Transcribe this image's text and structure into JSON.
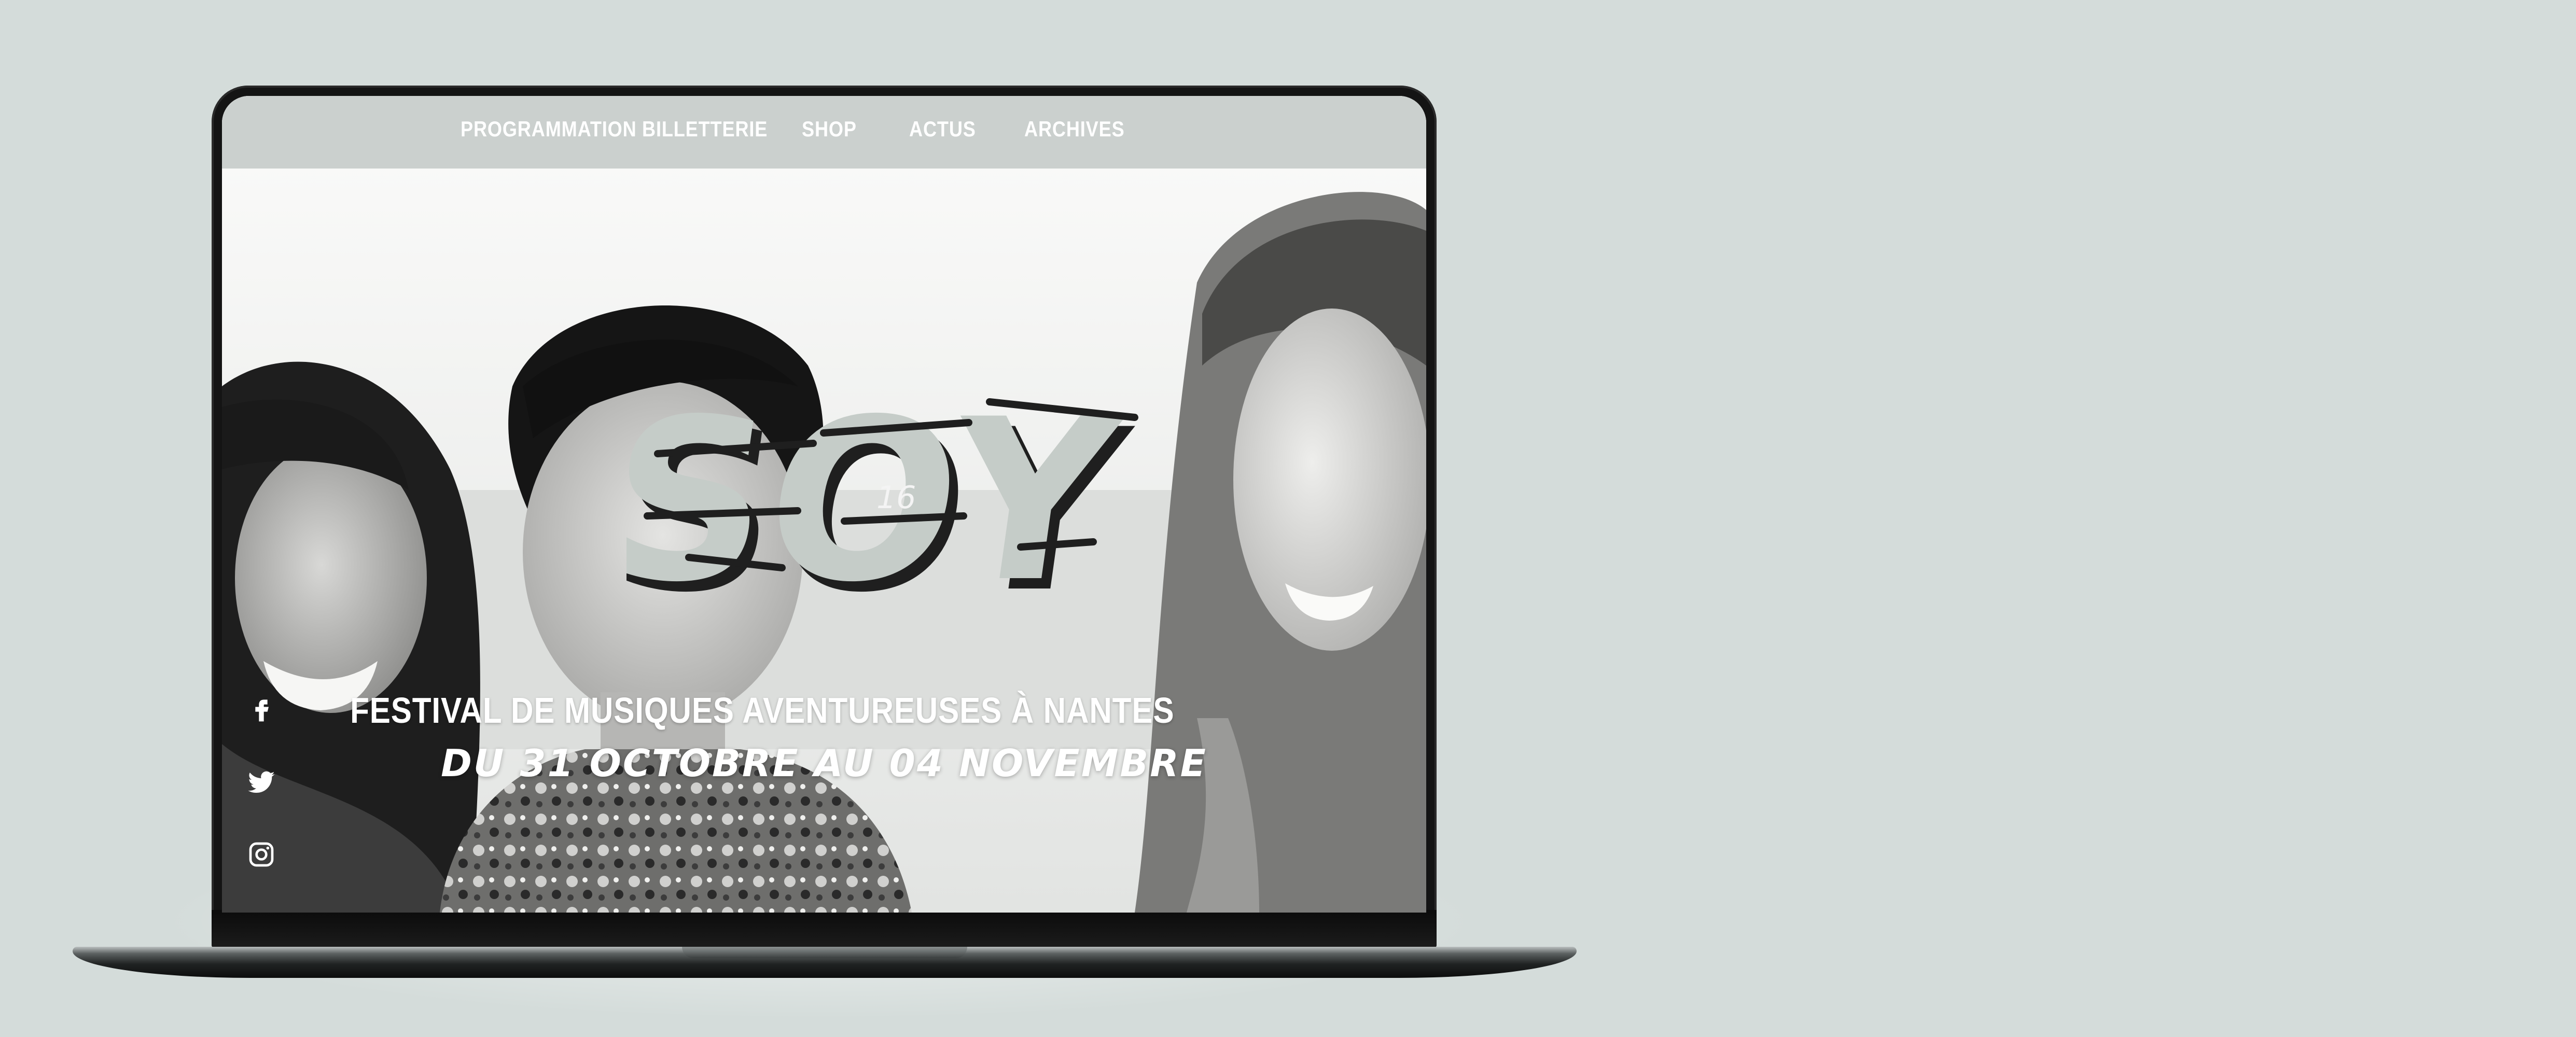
{
  "nav": {
    "items": [
      {
        "label": "PROGRAMMATION"
      },
      {
        "label": "BILLETTERIE"
      },
      {
        "label": "SHOP"
      },
      {
        "label": "ACTUS"
      },
      {
        "label": "ARCHIVES"
      }
    ]
  },
  "hero": {
    "logo_text": "SOY",
    "edition": "16",
    "subtitle": "FESTIVAL DE MUSIQUES AVENTUREUSES À NANTES",
    "dates": "DU 31 OCTOBRE AU 04 NOVEMBRE"
  },
  "social": [
    {
      "icon": "facebook-icon"
    },
    {
      "icon": "twitter-icon"
    },
    {
      "icon": "instagram-icon"
    }
  ],
  "colors": {
    "background": "#d4dcda",
    "logo_fill": "#c5ccc8",
    "logo_shadow": "#1f1f1f",
    "nav_text": "#ffffff"
  }
}
